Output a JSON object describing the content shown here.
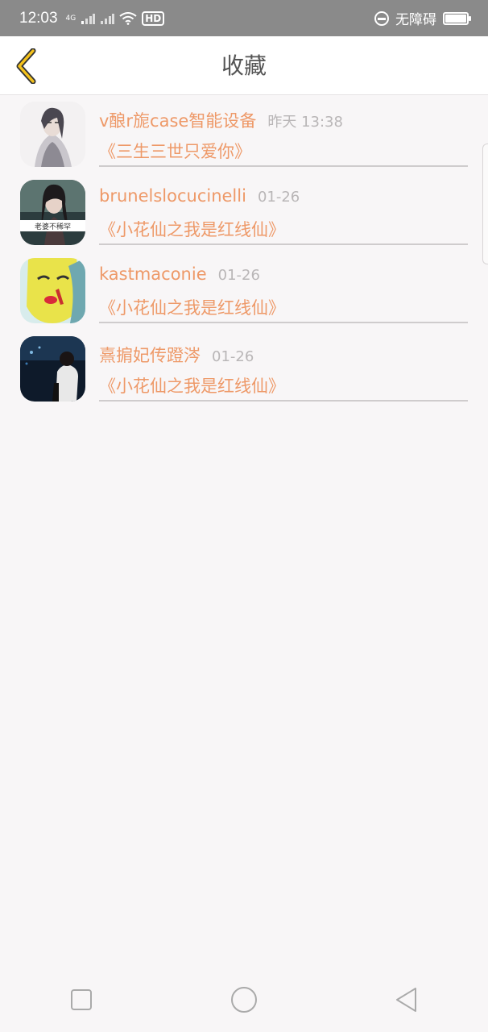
{
  "status_bar": {
    "time": "12:03",
    "network": "4G",
    "hd_label": "HD",
    "accessibility": "无障碍",
    "battery_level": 0.95
  },
  "header": {
    "title": "收藏",
    "back_icon": "chevron-left-icon",
    "accent": "#f4c21c"
  },
  "favorites": [
    {
      "name": "v酿r旎case智能设备",
      "time": "昨天 13:38",
      "book": "《三生三世只爱你》"
    },
    {
      "name": "brunelslocucinelli",
      "time": "01-26",
      "book": "《小花仙之我是红线仙》"
    },
    {
      "name": "kastmaconie",
      "time": "01-26",
      "book": "《小花仙之我是红线仙》"
    },
    {
      "name": "熹掮妃传蹬涔",
      "time": "01-26",
      "book": "《小花仙之我是红线仙》"
    }
  ],
  "avatar2_caption": "老婆不稀罕",
  "colors": {
    "name": "#ee9968",
    "time": "#b9b6b7",
    "background": "#f8f6f7"
  },
  "nav": {
    "recent": "square-icon",
    "home": "circle-icon",
    "back": "triangle-back-icon"
  }
}
